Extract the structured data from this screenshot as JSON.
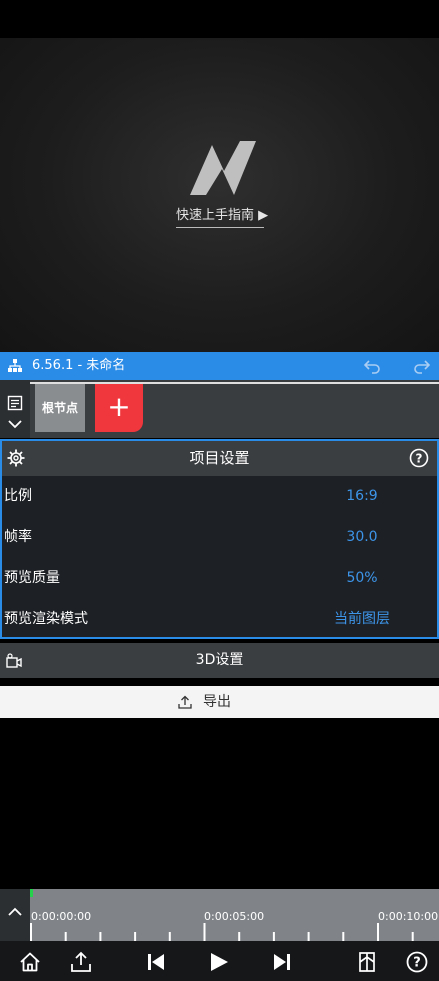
{
  "preview": {
    "logo_icon": "app-logo-icon",
    "guide_link": "快速上手指南 ▶"
  },
  "titlebar": {
    "title": "6.56.1 - 未命名",
    "color": "#2b8ce8"
  },
  "nodes": {
    "items": [
      {
        "label": "根节点"
      }
    ],
    "add_label": "+"
  },
  "project_settings": {
    "title": "项目设置",
    "rows": [
      {
        "label": "比例",
        "value": "16:9"
      },
      {
        "label": "帧率",
        "value": "30.0"
      },
      {
        "label": "预览质量",
        "value": "50%"
      },
      {
        "label": "预览渲染模式",
        "value": "当前图层"
      }
    ]
  },
  "settings_3d": {
    "label": "3D设置"
  },
  "export": {
    "label": "导出"
  },
  "timeline": {
    "times": [
      "0:00:00:00",
      "0:00:05:00",
      "0:00:10:00"
    ],
    "playhead_color": "#25d04a"
  },
  "toolbar": {
    "icons": [
      "home-icon",
      "share-icon",
      "skip-back-icon",
      "play-icon",
      "skip-forward-icon",
      "bookmark-icon",
      "help-icon"
    ]
  }
}
